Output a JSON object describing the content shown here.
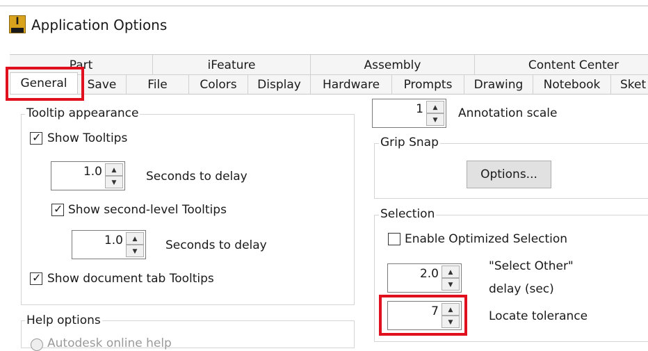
{
  "window": {
    "title": "Application Options",
    "icon_letter": "I"
  },
  "tabs_row1": [
    "Part",
    "iFeature",
    "Assembly",
    "Content Center"
  ],
  "tabs_row2": [
    "General",
    "Save",
    "File",
    "Colors",
    "Display",
    "Hardware",
    "Prompts",
    "Drawing",
    "Notebook",
    "Sket"
  ],
  "tooltip": {
    "group_label": "Tooltip appearance",
    "show_tooltips": "Show Tooltips",
    "delay1_value": "1.0",
    "delay1_label": "Seconds to delay",
    "show_second_level": "Show second-level Tooltips",
    "delay2_value": "1.0",
    "delay2_label": "Seconds to delay",
    "show_doc_tab": "Show document tab Tooltips"
  },
  "help": {
    "group_label": "Help options",
    "option1": "Autodesk online help"
  },
  "annotation": {
    "value": "1",
    "label": "Annotation scale"
  },
  "grip_snap": {
    "group_label": "Grip Snap",
    "options_button": "Options..."
  },
  "selection": {
    "group_label": "Selection",
    "enable_optimized": "Enable Optimized Selection",
    "select_other_value": "2.0",
    "select_other_label_line1": "\"Select Other\"",
    "select_other_label_line2": "delay (sec)",
    "locate_value": "7",
    "locate_label": "Locate tolerance"
  },
  "glyphs": {
    "check": "✓",
    "up": "▲",
    "down": "▼"
  },
  "colors": {
    "highlight": "#e0101e",
    "icon": "#d9a31d"
  }
}
